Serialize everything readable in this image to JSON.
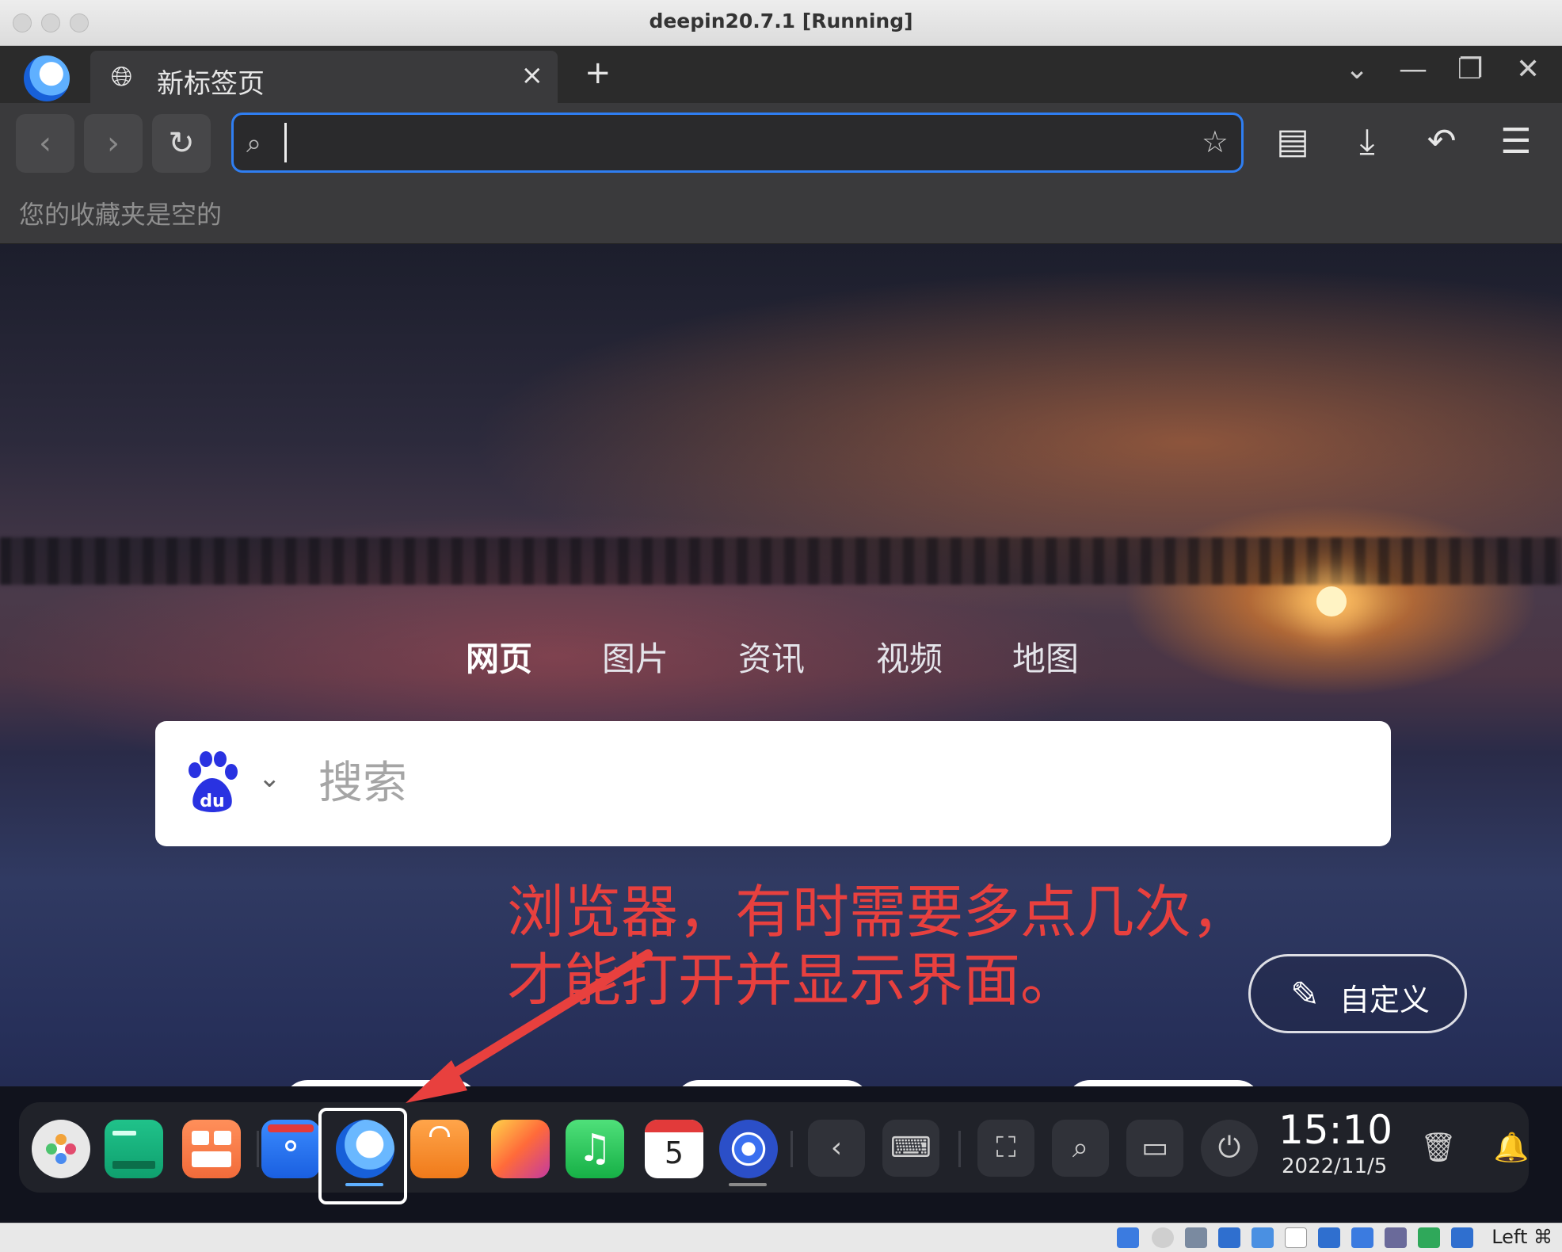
{
  "window": {
    "title": "deepin20.7.1 [Running]"
  },
  "browser": {
    "tab": {
      "title": "新标签页",
      "close_glyph": "×",
      "icon": "globe-icon"
    },
    "new_tab_glyph": "+",
    "window_controls": {
      "dropdown": "⌄",
      "minimize": "—",
      "restore": "❐",
      "close": "✕"
    },
    "nav": {
      "back": "‹",
      "forward": "›",
      "reload": "↻"
    },
    "address": {
      "value": "",
      "placeholder": "",
      "search_glyph": "⌕",
      "star_glyph": "☆"
    },
    "toolbar_icons": {
      "collections": "▤",
      "download": "⤓",
      "undo": "↶",
      "menu": "☰"
    },
    "bookmarks_bar": {
      "empty_text": "您的收藏夹是空的"
    }
  },
  "newtab": {
    "search_tabs": [
      "网页",
      "图片",
      "资讯",
      "视频",
      "地图"
    ],
    "active_tab_index": 0,
    "search": {
      "engine": "baidu-logo",
      "logo_text": "du",
      "caret": "⌄",
      "placeholder": "搜索",
      "value": ""
    },
    "customize_label": "自定义",
    "customize_icon": "✎"
  },
  "annotation": {
    "line1": "浏览器，有时需要多点几次，",
    "line2": "才能打开并显示界面。",
    "color": "#e8403e"
  },
  "dock": {
    "items": [
      {
        "name": "launcher-icon"
      },
      {
        "name": "terminal-icon"
      },
      {
        "name": "multitask-view-icon"
      },
      {
        "name": "file-manager-icon"
      },
      {
        "name": "browser-icon",
        "active": true
      },
      {
        "name": "app-store-icon"
      },
      {
        "name": "image-viewer-icon"
      },
      {
        "name": "music-icon"
      },
      {
        "name": "calendar-icon",
        "calendar_day": "5"
      },
      {
        "name": "control-center-icon"
      }
    ],
    "system": {
      "collapse": "‹",
      "keyboard": "⌨",
      "screenshot": "⛶",
      "search": "⌕",
      "onboard": "▭",
      "power": "⏻",
      "trash": "🗑",
      "notifications": "🔔"
    },
    "clock": {
      "time": "15:10",
      "date": "2022/11/5"
    }
  },
  "statusbar": {
    "host_key": "Left ⌘"
  }
}
